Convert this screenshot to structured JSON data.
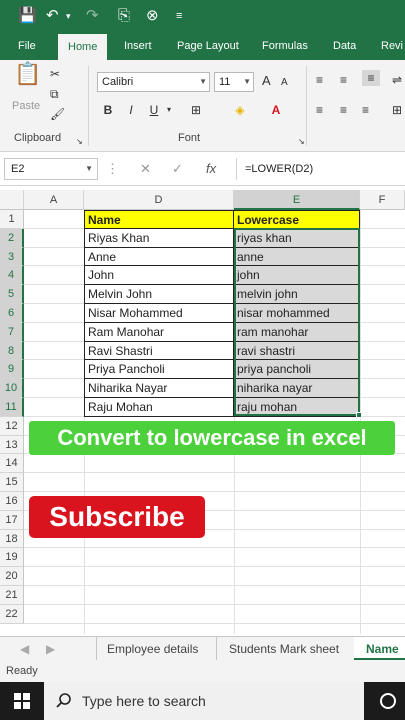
{
  "ribbon_tabs": [
    "File",
    "Home",
    "Insert",
    "Page Layout",
    "Formulas",
    "Data",
    "Revi"
  ],
  "active_tab": "Home",
  "clipboard": {
    "paste_label": "Paste",
    "group_label": "Clipboard"
  },
  "font": {
    "name": "Calibri",
    "size": "11",
    "group_label": "Font"
  },
  "formula_bar": {
    "cell_ref": "E2",
    "formula": "=LOWER(D2)"
  },
  "columns": [
    "A",
    "D",
    "E",
    "F"
  ],
  "rows": [
    "1",
    "2",
    "3",
    "4",
    "5",
    "6",
    "7",
    "8",
    "9",
    "10",
    "11",
    "12",
    "13",
    "14",
    "15",
    "16",
    "17",
    "18",
    "19",
    "20",
    "21",
    "22"
  ],
  "table": {
    "header": [
      "Name",
      "Lowercase"
    ],
    "names": [
      "Riyas Khan",
      "Anne",
      "John",
      "Melvin John",
      "Nisar Mohammed",
      "Ram Manohar",
      "Ravi Shastri",
      "Priya Pancholi",
      "Niharika Nayar",
      "Raju Mohan"
    ],
    "lowercase": [
      "riyas khan",
      "anne",
      "john",
      "melvin john",
      "nisar mohammed",
      "ram manohar",
      "ravi shastri",
      "priya pancholi",
      "niharika nayar",
      "raju mohan"
    ]
  },
  "banner": "Convert to lowercase in excel",
  "subscribe": "Subscribe",
  "sheets": [
    "Employee details",
    "Students Mark sheet",
    "Name"
  ],
  "active_sheet": "Name",
  "status": "Ready",
  "taskbar": {
    "search_placeholder": "Type here to search"
  },
  "colors": {
    "excel_green": "#217346",
    "header_fill": "#ffff00",
    "banner": "#4cd13c",
    "subscribe": "#d9141f"
  }
}
